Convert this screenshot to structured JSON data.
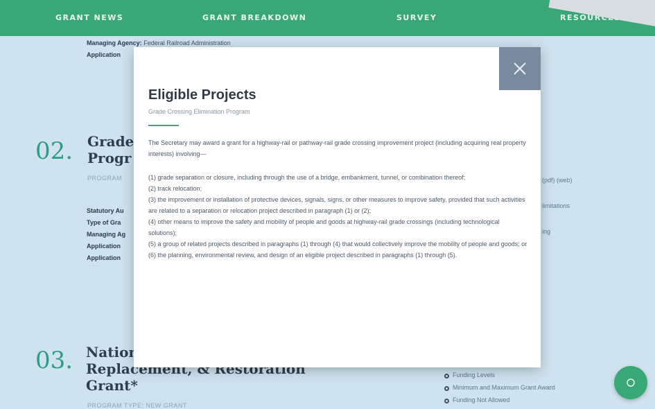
{
  "nav": {
    "items": [
      "GRANT NEWS",
      "GRANT BREAKDOWN",
      "SURVEY",
      "RESOURCES"
    ]
  },
  "background": {
    "top_meta": {
      "managing_label": "Managing Agency:",
      "managing_value": "Federal Railroad Administration",
      "application_label": "Application"
    },
    "section2": {
      "number": "02.",
      "title_line1": "Grade",
      "title_line2": "Progr",
      "sub": "PROGRAM",
      "meta_labels": [
        "Statutory Au",
        "Type of Gra",
        "Managing Ag",
        "Application",
        "Application"
      ],
      "right_fragments": [
        "(pdf) (web)",
        "limitations",
        "ing"
      ]
    },
    "section3": {
      "number": "03.",
      "title_line1": "Nation",
      "title_line2": "Replacement, & Restoration",
      "title_line3": "Grant*",
      "sub": "PROGRAM TYPE: NEW GRANT",
      "list": [
        "Funding Levels",
        "Minimum and Maximum Grant Award",
        "Funding Not Allowed"
      ]
    }
  },
  "modal": {
    "title": "Eligible Projects",
    "subtitle": "Grade Crossing Elimination Program",
    "intro": "The Secretary may award a grant for a highway-rail or pathway-rail grade crossing improvement project (including acquiring real property interests) involving—",
    "items": [
      "(1) grade separation or closure, including through the use of a bridge, embankment, tunnel, or combination thereof;",
      "(2) track relocation;",
      "(3) the improvement or installation of protective devices, signals, signs, or other measures to improve safety, provided that such activities are related to a separation or relocation project described in paragraph (1) or (2);",
      "(4) other means to improve the safety and mobility of people and goods at highway-rail grade crossings (including technological solutions);",
      "(5) a group of related projects described in paragraphs (1) through (4) that would collectively improve the mobility of people and goods; or",
      "(6) the planning, environmental review, and design of an eligible project described in paragraphs (1) through (5)."
    ]
  },
  "colors": {
    "accent": "#3aa876",
    "close_bg": "#7a8a9e",
    "page_bg": "#cfe3ef"
  }
}
